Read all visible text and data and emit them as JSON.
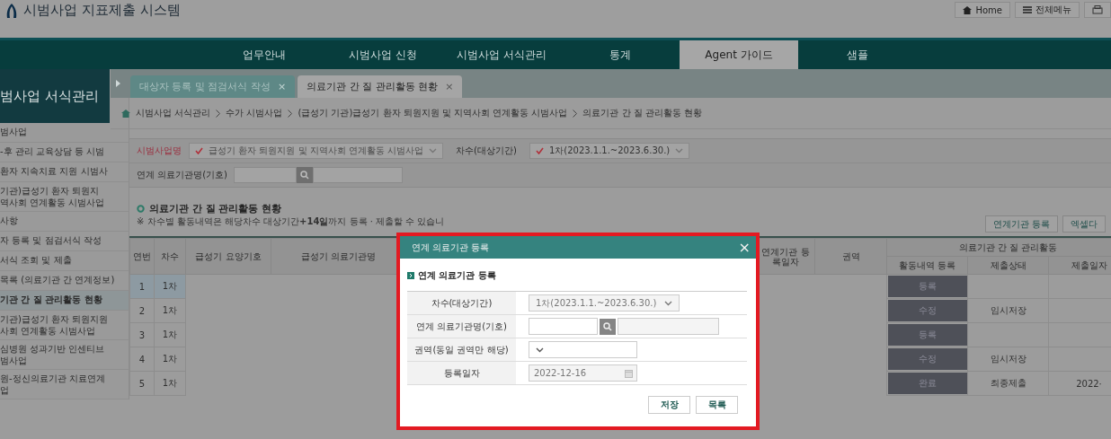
{
  "header": {
    "title": "시범사업 지표제출 시스템",
    "buttons": [
      {
        "kind": "home",
        "label": "Home"
      },
      {
        "kind": "menu",
        "label": "전체메뉴"
      },
      {
        "kind": "print"
      }
    ]
  },
  "nav": [
    {
      "label": "업무안내",
      "selected": false
    },
    {
      "label": "시범사업 신청",
      "selected": false
    },
    {
      "label": "시범사업 서식관리",
      "selected": false
    },
    {
      "label": "통계",
      "selected": false
    },
    {
      "label": "Agent 가이드",
      "selected": true
    },
    {
      "label": "샘플",
      "selected": false
    }
  ],
  "sidebar": {
    "title": "범사업 서식관리",
    "items": [
      {
        "lines": [
          "범사업"
        ],
        "selected": false
      },
      {
        "lines": [
          "-후 관리 교육상담 등 시범"
        ],
        "selected": false
      },
      {
        "lines": [
          "환자 지속치료 지원 시범사"
        ],
        "selected": false
      },
      {
        "lines": [
          "기관)급성기 환자 퇴원지",
          "역사회 연계활동 시범사업"
        ],
        "selected": false
      },
      {
        "lines": [
          "사항"
        ],
        "selected": false
      },
      {
        "lines": [
          "자 등록 및 점검서식 작성"
        ],
        "selected": false
      },
      {
        "lines": [
          "서식 조회 및 제출"
        ],
        "selected": false
      },
      {
        "lines": [
          "목록 (의료기관 간 연계정보)"
        ],
        "selected": false
      },
      {
        "lines": [
          "기관 간 질 관리활동 현황"
        ],
        "selected": true
      },
      {
        "lines": [
          "기관)급성기 환자 퇴원지원",
          "사회 연계활동 시범사업"
        ],
        "selected": false
      },
      {
        "lines": [
          "심병원 성과기반 인센티브",
          "범사업"
        ],
        "selected": false
      },
      {
        "lines": [
          "원-정신의료기관 치료연계",
          "업"
        ],
        "selected": false
      }
    ]
  },
  "tabs": [
    {
      "label": "대상자 등록 및 점검서식 작성",
      "close": "×",
      "selected": false
    },
    {
      "label": "의료기관 간 질 관리활동 현황",
      "close": "×",
      "selected": true
    }
  ],
  "breadcrumb": [
    "시범사업 서식관리",
    "수가 시범사업",
    "(급성기 기관)급성기 환자 퇴원지원 및 지역사회 연계활동 시범사업",
    "의료기관 간 질 관리활동 현황"
  ],
  "filters": {
    "program": {
      "label": "시범사업명",
      "value": "급성기 환자 퇴원지원 및 지역사회 연계활동 시범사업"
    },
    "round": {
      "label": "차수(대상기간)",
      "value": "1차(2023.1.1.~2023.6.30.)"
    },
    "partner": {
      "label": "연계 의료기관명(기호)"
    }
  },
  "section": {
    "title": "의료기관 간 질 관리활동 현황",
    "note": "※ 차수별 활동내역은 해당차수 대상기간**+14일**까지 등록 · 제출할 수 있습니",
    "buttons": [
      "연계기관 등록",
      "엑셀다"
    ]
  },
  "table": {
    "columns": [
      "연번",
      "차수",
      "급성기 요양기호",
      "급성기 의료기관명",
      "연계기관 등록일자",
      "권역"
    ],
    "group": {
      "label": "의료기관 간 질 관리활동",
      "columns": [
        "활동내역 등록",
        "제출상태",
        "제출일자"
      ]
    },
    "rows": [
      {
        "no": "1",
        "round": "1차",
        "action": "등록",
        "selected": true
      },
      {
        "no": "2",
        "round": "1차",
        "action": "수정",
        "status": "임시저장",
        "selected": false
      },
      {
        "no": "3",
        "round": "1차",
        "action": "등록",
        "selected": false
      },
      {
        "no": "4",
        "round": "1차",
        "action": "수정",
        "status": "임시저장",
        "selected": false
      },
      {
        "no": "5",
        "round": "1차",
        "action": "완료",
        "status": "최종제출",
        "date": "2022·",
        "selected": false
      }
    ]
  },
  "modal": {
    "title": "연계 의료기관 등록",
    "close": "×",
    "subtitle": "연계 의료기관 등록",
    "fields": [
      {
        "kind": "select",
        "label": "차수(대상기간)",
        "value": "1차(2023.1.1.~2023.6.30.)",
        "disabled": true
      },
      {
        "kind": "search",
        "label": "연계 의료기관명(기호)"
      },
      {
        "kind": "select",
        "label": "권역(동일 권역만 해당)",
        "disabled": false
      },
      {
        "kind": "date",
        "label": "등록일자",
        "value": "2022-12-16",
        "disabled": true
      }
    ],
    "buttons": [
      "저장",
      "목록"
    ]
  }
}
